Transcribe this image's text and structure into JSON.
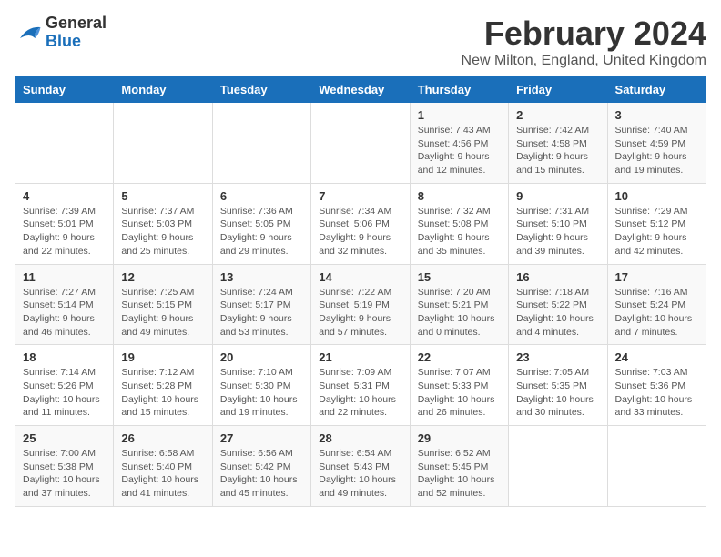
{
  "logo": {
    "line1": "General",
    "line2": "Blue"
  },
  "title": "February 2024",
  "location": "New Milton, England, United Kingdom",
  "weekdays": [
    "Sunday",
    "Monday",
    "Tuesday",
    "Wednesday",
    "Thursday",
    "Friday",
    "Saturday"
  ],
  "weeks": [
    [
      {
        "day": "",
        "info": ""
      },
      {
        "day": "",
        "info": ""
      },
      {
        "day": "",
        "info": ""
      },
      {
        "day": "",
        "info": ""
      },
      {
        "day": "1",
        "info": "Sunrise: 7:43 AM\nSunset: 4:56 PM\nDaylight: 9 hours\nand 12 minutes."
      },
      {
        "day": "2",
        "info": "Sunrise: 7:42 AM\nSunset: 4:58 PM\nDaylight: 9 hours\nand 15 minutes."
      },
      {
        "day": "3",
        "info": "Sunrise: 7:40 AM\nSunset: 4:59 PM\nDaylight: 9 hours\nand 19 minutes."
      }
    ],
    [
      {
        "day": "4",
        "info": "Sunrise: 7:39 AM\nSunset: 5:01 PM\nDaylight: 9 hours\nand 22 minutes."
      },
      {
        "day": "5",
        "info": "Sunrise: 7:37 AM\nSunset: 5:03 PM\nDaylight: 9 hours\nand 25 minutes."
      },
      {
        "day": "6",
        "info": "Sunrise: 7:36 AM\nSunset: 5:05 PM\nDaylight: 9 hours\nand 29 minutes."
      },
      {
        "day": "7",
        "info": "Sunrise: 7:34 AM\nSunset: 5:06 PM\nDaylight: 9 hours\nand 32 minutes."
      },
      {
        "day": "8",
        "info": "Sunrise: 7:32 AM\nSunset: 5:08 PM\nDaylight: 9 hours\nand 35 minutes."
      },
      {
        "day": "9",
        "info": "Sunrise: 7:31 AM\nSunset: 5:10 PM\nDaylight: 9 hours\nand 39 minutes."
      },
      {
        "day": "10",
        "info": "Sunrise: 7:29 AM\nSunset: 5:12 PM\nDaylight: 9 hours\nand 42 minutes."
      }
    ],
    [
      {
        "day": "11",
        "info": "Sunrise: 7:27 AM\nSunset: 5:14 PM\nDaylight: 9 hours\nand 46 minutes."
      },
      {
        "day": "12",
        "info": "Sunrise: 7:25 AM\nSunset: 5:15 PM\nDaylight: 9 hours\nand 49 minutes."
      },
      {
        "day": "13",
        "info": "Sunrise: 7:24 AM\nSunset: 5:17 PM\nDaylight: 9 hours\nand 53 minutes."
      },
      {
        "day": "14",
        "info": "Sunrise: 7:22 AM\nSunset: 5:19 PM\nDaylight: 9 hours\nand 57 minutes."
      },
      {
        "day": "15",
        "info": "Sunrise: 7:20 AM\nSunset: 5:21 PM\nDaylight: 10 hours\nand 0 minutes."
      },
      {
        "day": "16",
        "info": "Sunrise: 7:18 AM\nSunset: 5:22 PM\nDaylight: 10 hours\nand 4 minutes."
      },
      {
        "day": "17",
        "info": "Sunrise: 7:16 AM\nSunset: 5:24 PM\nDaylight: 10 hours\nand 7 minutes."
      }
    ],
    [
      {
        "day": "18",
        "info": "Sunrise: 7:14 AM\nSunset: 5:26 PM\nDaylight: 10 hours\nand 11 minutes."
      },
      {
        "day": "19",
        "info": "Sunrise: 7:12 AM\nSunset: 5:28 PM\nDaylight: 10 hours\nand 15 minutes."
      },
      {
        "day": "20",
        "info": "Sunrise: 7:10 AM\nSunset: 5:30 PM\nDaylight: 10 hours\nand 19 minutes."
      },
      {
        "day": "21",
        "info": "Sunrise: 7:09 AM\nSunset: 5:31 PM\nDaylight: 10 hours\nand 22 minutes."
      },
      {
        "day": "22",
        "info": "Sunrise: 7:07 AM\nSunset: 5:33 PM\nDaylight: 10 hours\nand 26 minutes."
      },
      {
        "day": "23",
        "info": "Sunrise: 7:05 AM\nSunset: 5:35 PM\nDaylight: 10 hours\nand 30 minutes."
      },
      {
        "day": "24",
        "info": "Sunrise: 7:03 AM\nSunset: 5:36 PM\nDaylight: 10 hours\nand 33 minutes."
      }
    ],
    [
      {
        "day": "25",
        "info": "Sunrise: 7:00 AM\nSunset: 5:38 PM\nDaylight: 10 hours\nand 37 minutes."
      },
      {
        "day": "26",
        "info": "Sunrise: 6:58 AM\nSunset: 5:40 PM\nDaylight: 10 hours\nand 41 minutes."
      },
      {
        "day": "27",
        "info": "Sunrise: 6:56 AM\nSunset: 5:42 PM\nDaylight: 10 hours\nand 45 minutes."
      },
      {
        "day": "28",
        "info": "Sunrise: 6:54 AM\nSunset: 5:43 PM\nDaylight: 10 hours\nand 49 minutes."
      },
      {
        "day": "29",
        "info": "Sunrise: 6:52 AM\nSunset: 5:45 PM\nDaylight: 10 hours\nand 52 minutes."
      },
      {
        "day": "",
        "info": ""
      },
      {
        "day": "",
        "info": ""
      }
    ]
  ]
}
